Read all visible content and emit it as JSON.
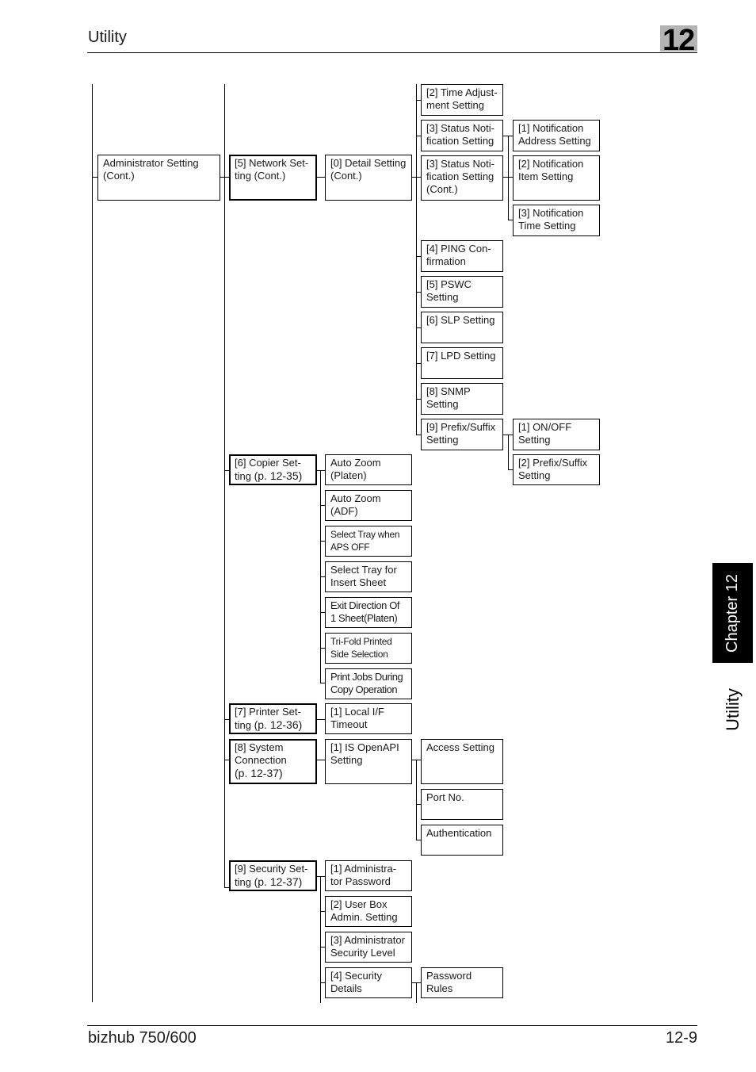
{
  "header": {
    "title": "Utility",
    "chapter_number": "12"
  },
  "footer": {
    "model": "bizhub 750/600",
    "page": "12-9"
  },
  "side_tab": {
    "chapter_label": "Chapter 12",
    "section_label": "Utility"
  },
  "tree": {
    "admin": "Administrator Setting (Cont.)",
    "network": "[5] Network Set-ting (Cont.)",
    "detail": "[0] Detail Setting (Cont.)",
    "time_adjust": "[2] Time Adjust-ment Setting",
    "status_notif": "[3] Status Noti-fication Setting",
    "status_notif_cont": "[3] Status Noti-fication Setting (Cont.)",
    "notif_address": "[1] Notification Address Setting",
    "notif_item": "[2] Notification Item Setting",
    "notif_time": "[3] Notification Time Setting",
    "ping": "[4] PING Con-firmation",
    "pswc": "[5] PSWC Setting",
    "slp": "[6] SLP Setting",
    "lpd": "[7] LPD Setting",
    "snmp": "[8] SNMP Setting",
    "prefix": "[9] Prefix/Suffix Setting",
    "onoff": "[1] ON/OFF Setting",
    "prefix_suffix": "[2] Prefix/Suffix Setting",
    "copier": "[6] Copier Set-ting",
    "copier_ref": "(p. 12-35)",
    "copier_items": [
      "Auto Zoom (Platen)",
      "Auto Zoom (ADF)",
      "Select Tray when APS OFF",
      "Select Tray for Insert Sheet",
      "Exit Direction Of 1 Sheet(Platen)",
      "Tri-Fold Printed Side Selection",
      "Print Jobs During Copy Operation"
    ],
    "printer": "[7] Printer Set-ting",
    "printer_ref": "(p. 12-36)",
    "local_if": "[1] Local I/F Timeout",
    "system": "[8] System Connection",
    "system_ref": "(p. 12-37)",
    "openapi": "[1] IS OpenAPI Setting",
    "access": "Access Setting",
    "port": "Port No.",
    "auth": "Authentication",
    "security": "[9] Security Set-ting",
    "security_ref": "(p. 12-37)",
    "security_items": [
      "[1] Administra-tor Password",
      "[2] User Box Admin. Setting",
      "[3] Administrator Security Level",
      "[4] Security Details"
    ],
    "password_rules": "Password Rules"
  }
}
